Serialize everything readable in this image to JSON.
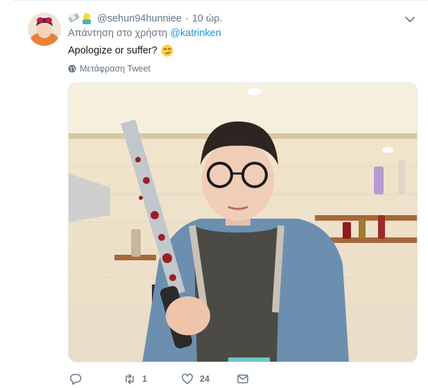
{
  "tweet": {
    "handle": "@sehun94hunniee",
    "separator": "·",
    "time": "10 ώρ.",
    "reply_prefix": "Απάντηση στο χρήστη",
    "reply_mention": "@katrinken",
    "text": "Apologize or suffer?",
    "translate_label": "Μετάφραση Tweet"
  },
  "actions": {
    "retweet_count": "1",
    "like_count": "24"
  },
  "icons": [
    "caret-down-icon",
    "globe-icon",
    "reply-icon",
    "retweet-icon",
    "like-icon",
    "message-icon",
    "smirk-emoji-icon"
  ],
  "colors": {
    "link": "#1b95e0",
    "muted": "#657786",
    "text": "#14171a"
  }
}
